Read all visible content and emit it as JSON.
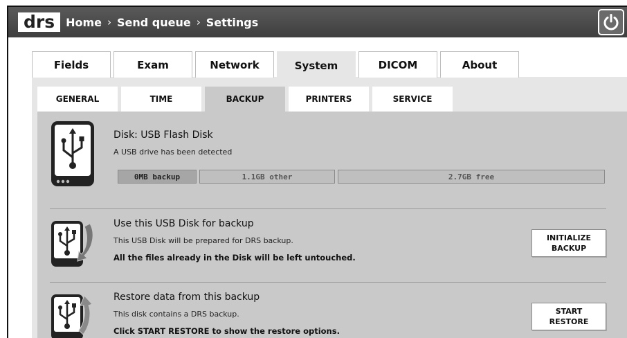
{
  "app": {
    "logo": "drs"
  },
  "breadcrumb": [
    {
      "label": "Home"
    },
    {
      "label": "Send queue"
    },
    {
      "label": "Settings"
    }
  ],
  "breadcrumb_separator": "›",
  "main_tabs": [
    {
      "label": "Fields"
    },
    {
      "label": "Exam"
    },
    {
      "label": "Network"
    },
    {
      "label": "System",
      "active": true
    },
    {
      "label": "DICOM"
    },
    {
      "label": "About"
    }
  ],
  "sub_tabs": [
    {
      "label": "GENERAL"
    },
    {
      "label": "TIME"
    },
    {
      "label": "BACKUP",
      "active": true
    },
    {
      "label": "PRINTERS"
    },
    {
      "label": "SERVICE"
    }
  ],
  "disk": {
    "title": "Disk: USB Flash Disk",
    "subtitle": "A USB drive has been detected",
    "usage": {
      "backup_label": "0MB backup",
      "other_label": "1.1GB other",
      "free_label": "2.7GB free"
    }
  },
  "use_backup": {
    "title": "Use this USB Disk for backup",
    "description": "This USB Disk will be prepared for DRS backup.",
    "note": "All the files already in the Disk will be left untouched.",
    "button_line1": "INITIALIZE",
    "button_line2": "BACKUP"
  },
  "restore": {
    "title": "Restore data from this backup",
    "description": "This disk contains a DRS backup.",
    "note": "Click START RESTORE to show the restore options.",
    "button_line1": "START",
    "button_line2": "RESTORE"
  },
  "colors": {
    "topbar": "#4a4a4a",
    "panel": "#c9c9c9",
    "tab_area": "#e6e6e6"
  },
  "icons": {
    "power": "power-icon",
    "usb_device": "usb-device-icon",
    "usb_backup": "usb-backup-icon",
    "usb_restore": "usb-restore-icon"
  }
}
